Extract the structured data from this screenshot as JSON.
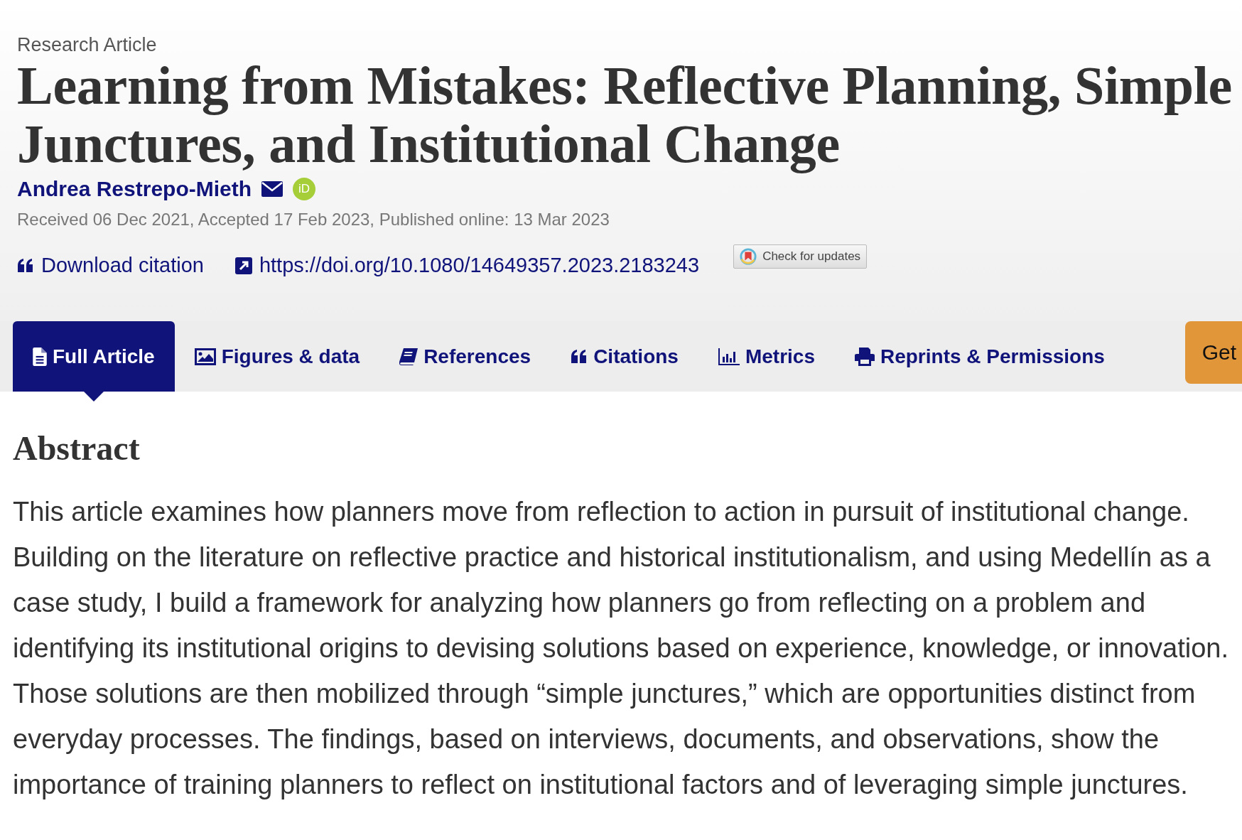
{
  "article_type": "Research Article",
  "title": "Learning from Mistakes: Reflective Planning, Simple Junctures, and Institutional Change",
  "author": {
    "name": "Andrea Restrepo-Mieth",
    "orcid_badge": "iD"
  },
  "dates": "Received 06 Dec 2021, Accepted 17 Feb 2023, Published online: 13 Mar 2023",
  "links": [
    {
      "label": "Download citation"
    },
    {
      "label": "https://doi.org/10.1080/14649357.2023.2183243"
    }
  ],
  "check_updates": {
    "label": "Check for updates"
  },
  "tabs": [
    {
      "label": "Full Article",
      "selected": true
    },
    {
      "label": "Figures & data",
      "selected": false
    },
    {
      "label": "References",
      "selected": false
    },
    {
      "label": "Citations",
      "selected": false
    },
    {
      "label": "Metrics",
      "selected": false
    },
    {
      "label": "Reprints & Permissions",
      "selected": false
    }
  ],
  "access_button": {
    "label": "Get"
  },
  "abstract": {
    "heading": "Abstract",
    "text": "This article examines how planners move from reflection to action in pursuit of institutional change. Building on the literature on reflective practice and historical institutionalism, and using Medellín as a case study, I build a framework for analyzing how planners go from reflecting on a problem and identifying its institutional origins to devising solutions based on experience, knowledge, or innovation. Those solutions are then mobilized through “simple junctures,” which are opportunities distinct from everyday processes. The findings, based on interviews, documents, and observations, show the importance of training planners to reflect on institutional factors and of leveraging simple junctures."
  }
}
